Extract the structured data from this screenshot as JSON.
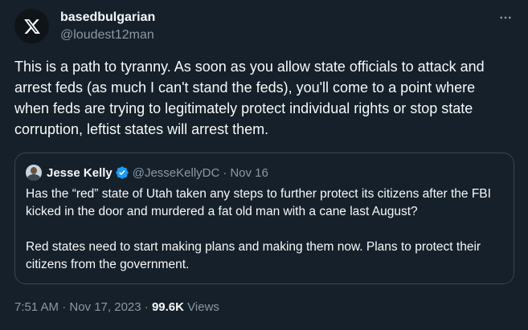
{
  "author": {
    "display_name": "basedbulgarian",
    "handle": "@loudest12man",
    "avatar_icon": "x-logo-icon"
  },
  "menu_icon": "more-horizontal-icon",
  "body": "This is a path to tyranny. As soon as you allow state officials to attack and arrest feds (as much I can't stand the feds), you'll come to a point where when feds are trying to legitimately protect individual rights or stop state corruption, leftist states will arrest them.",
  "quote": {
    "display_name": "Jesse Kelly",
    "verified_icon": "verified-badge-icon",
    "handle": "@JesseKellyDC",
    "separator": "·",
    "date": "Nov 16",
    "paragraphs": [
      "Has the “red” state of Utah taken any steps to further protect its citizens after the FBI kicked in the door and murdered a fat old man with a cane last August?",
      "Red states need to start making plans and making them now. Plans to protect their citizens from the government."
    ]
  },
  "meta": {
    "timestamp": "7:51 AM · Nov 17, 2023",
    "separator": "·",
    "views_count": "99.6K",
    "views_label": "Views"
  },
  "colors": {
    "background": "#15202b",
    "text": "#f7f9f9",
    "secondary": "#8b98a5",
    "border": "#38444d",
    "verified": "#1d9bf0"
  }
}
